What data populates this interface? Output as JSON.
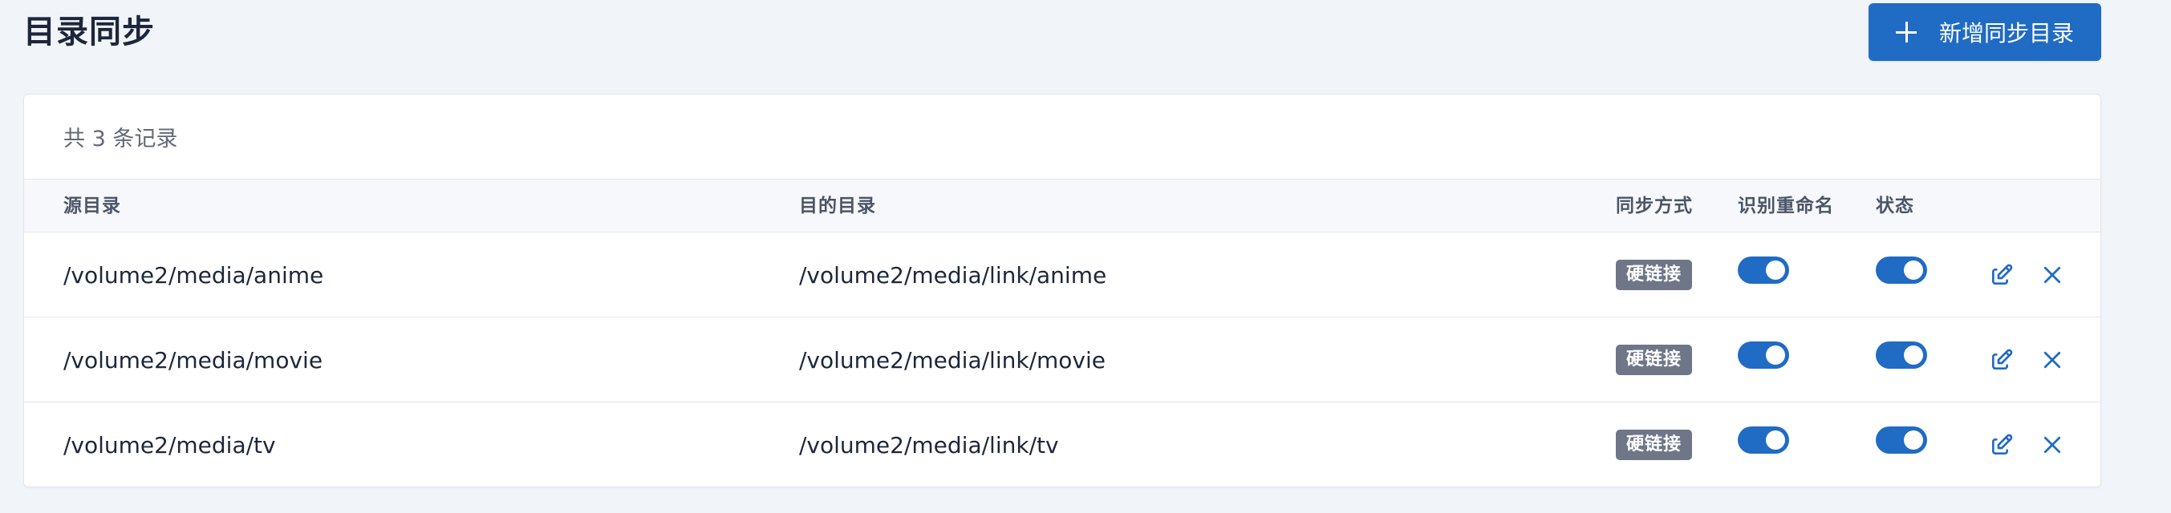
{
  "page": {
    "title": "目录同步"
  },
  "toolbar": {
    "add_label": "新增同步目录",
    "add_icon": "plus-icon"
  },
  "card": {
    "record_count_text": "共 3 条记录"
  },
  "table": {
    "columns": {
      "source": "源目录",
      "target": "目的目录",
      "mode": "同步方式",
      "rename": "识别重命名",
      "status": "状态"
    },
    "rows": [
      {
        "source": "/volume2/media/anime",
        "target": "/volume2/media/link/anime",
        "mode": "硬链接",
        "rename_enabled": true,
        "status_enabled": true
      },
      {
        "source": "/volume2/media/movie",
        "target": "/volume2/media/link/movie",
        "mode": "硬链接",
        "rename_enabled": true,
        "status_enabled": true
      },
      {
        "source": "/volume2/media/tv",
        "target": "/volume2/media/link/tv",
        "mode": "硬链接",
        "rename_enabled": true,
        "status_enabled": true
      }
    ],
    "row_action_icons": [
      "edit-icon",
      "close-icon"
    ]
  },
  "colors": {
    "accent": "#206bc4",
    "page_background": "#f1f4f9",
    "badge_background": "#6e7687"
  }
}
